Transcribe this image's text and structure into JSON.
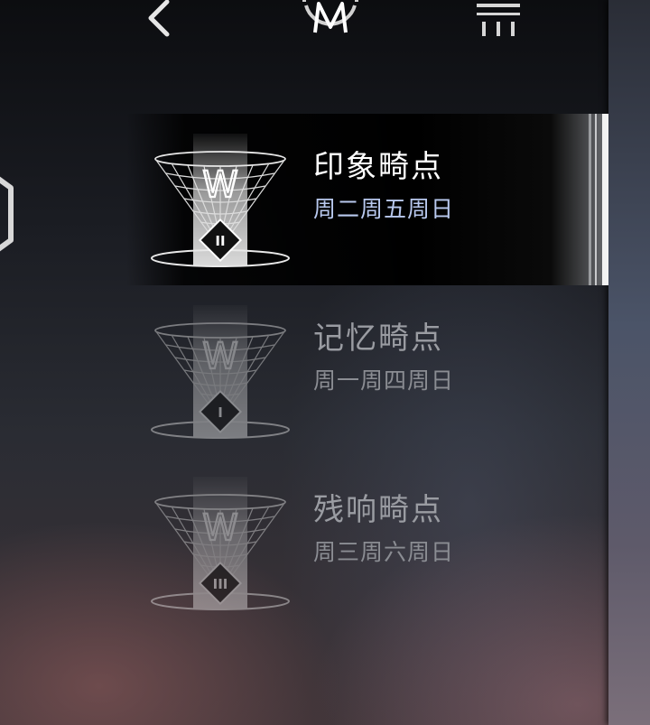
{
  "header": {
    "back_icon": "chevron-left-icon",
    "logo_icon": "m-emblem-icon",
    "menu_icon": "menu-bars-icon"
  },
  "points": [
    {
      "title": "印象畸点",
      "schedule": "周二周五周日",
      "tier": "II",
      "funnel_letter": "W",
      "selected": true
    },
    {
      "title": "记忆畸点",
      "schedule": "周一周四周日",
      "tier": "I",
      "funnel_letter": "W",
      "selected": false
    },
    {
      "title": "残响畸点",
      "schedule": "周三周六周日",
      "tier": "III",
      "funnel_letter": "W",
      "selected": false
    }
  ],
  "colors": {
    "accent_text": "#b9c9ef",
    "selected_bg": "#000000",
    "dim_text": "#9a9ca2"
  }
}
